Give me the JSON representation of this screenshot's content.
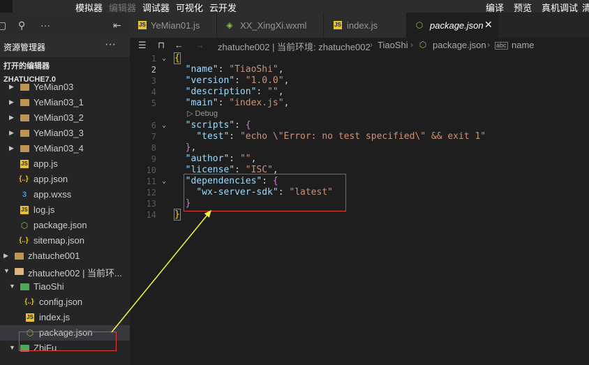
{
  "menu": {
    "left": [
      "模拟器",
      "编辑器",
      "调试器",
      "可视化",
      "云开发"
    ],
    "right": [
      "编译",
      "预览",
      "真机调试",
      "清"
    ]
  },
  "sidebar": {
    "title": "资源管理器",
    "more": "···",
    "open_editors": "打开的编辑器",
    "project": "ZHATUCHE7.0",
    "items": [
      {
        "label": "YeMian03",
        "kind": "folder"
      },
      {
        "label": "YeMian03_1",
        "kind": "folder"
      },
      {
        "label": "YeMian03_2",
        "kind": "folder"
      },
      {
        "label": "YeMian03_3",
        "kind": "folder"
      },
      {
        "label": "YeMian03_4",
        "kind": "folder"
      },
      {
        "label": "app.js",
        "kind": "js"
      },
      {
        "label": "app.json",
        "kind": "json"
      },
      {
        "label": "app.wxss",
        "kind": "css"
      },
      {
        "label": "log.js",
        "kind": "js"
      },
      {
        "label": "package.json",
        "kind": "pkg"
      },
      {
        "label": "sitemap.json",
        "kind": "json"
      },
      {
        "label": "zhatuche001",
        "kind": "folder"
      },
      {
        "label": "zhatuche002 | 当前环...",
        "kind": "folder-open"
      },
      {
        "label": "TiaoShi",
        "kind": "folder-green"
      },
      {
        "label": "config.json",
        "kind": "json"
      },
      {
        "label": "index.js",
        "kind": "js"
      },
      {
        "label": "package.json",
        "kind": "pkg"
      },
      {
        "label": "ZhiFu",
        "kind": "folder-green"
      }
    ]
  },
  "tabs": [
    {
      "label": "YeMian01.js",
      "icon": "js"
    },
    {
      "label": "XX_XingXi.wxml",
      "icon": "wxml"
    },
    {
      "label": "index.js",
      "icon": "js"
    },
    {
      "label": "package.json",
      "icon": "pkg",
      "active": true,
      "close": "✕"
    }
  ],
  "breadcrumbs": [
    "zhatuche002 | 当前环境: zhatuche002",
    "TiaoShi",
    "package.json",
    "name"
  ],
  "editor": {
    "line_numbers": [
      "1",
      "2",
      "3",
      "4",
      "5",
      "6",
      "7",
      "8",
      "9",
      "10",
      "11",
      "12",
      "13",
      "14"
    ],
    "current_line": "2",
    "codelens": "▷ Debug",
    "lines": {
      "l2_key": "\"name\"",
      "l2_val": "\"TiaoShi\"",
      "l3_key": "\"version\"",
      "l3_val": "\"1.0.0\"",
      "l4_key": "\"description\"",
      "l4_val": "\"\"",
      "l5_key": "\"main\"",
      "l5_val": "\"index.js\"",
      "l6_key": "\"scripts\"",
      "l7_key": "\"test\"",
      "l7_val": "\"echo \\\"Error: no test specified\\\" && exit 1\"",
      "l9_key": "\"author\"",
      "l9_val": "\"\"",
      "l10_key": "\"license\"",
      "l10_val": "\"ISC\"",
      "l11_key": "\"dependencies\"",
      "l12_key": "\"wx-server-sdk\"",
      "l12_val": "\"latest\""
    }
  },
  "colors": {
    "annotation_box": "#e03a3a",
    "annotation_arrow": "#f5f542"
  }
}
